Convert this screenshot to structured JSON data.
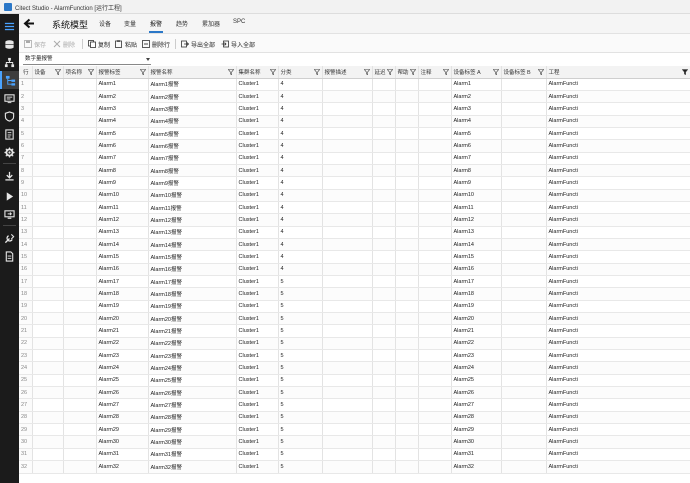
{
  "window": {
    "title": "Citect Studio - AlarmFunction [运行工程]"
  },
  "sidebar": {
    "items": [
      {
        "name": "menu-icon",
        "active": false
      },
      {
        "name": "database-icon",
        "active": false
      },
      {
        "name": "topology-icon",
        "active": false
      },
      {
        "name": "system-model-icon",
        "active": true
      },
      {
        "name": "visualization-icon",
        "active": false
      },
      {
        "name": "security-icon",
        "active": false
      },
      {
        "name": "reports-icon",
        "active": false
      },
      {
        "name": "settings-icon",
        "active": false
      },
      {
        "name": "download-icon",
        "active": false
      },
      {
        "name": "run-icon",
        "active": false
      },
      {
        "name": "deploy-icon",
        "active": false
      },
      {
        "name": "tools-icon",
        "active": false
      },
      {
        "name": "document-icon",
        "active": false
      }
    ]
  },
  "nav": {
    "title": "系统模型",
    "tabs": [
      {
        "label": "设备",
        "active": false
      },
      {
        "label": "变量",
        "active": false
      },
      {
        "label": "报警",
        "active": true
      },
      {
        "label": "趋势",
        "active": false
      },
      {
        "label": "累加器",
        "active": false
      },
      {
        "label": "SPC",
        "active": false
      }
    ]
  },
  "toolbar": {
    "save": "保存",
    "delete": "删除",
    "copy": "复制",
    "paste": "粘贴",
    "delete_row": "删除行",
    "export_all": "导出全部",
    "import_all": "导入全部"
  },
  "filter": {
    "selected": "数字量报警"
  },
  "grid": {
    "columns": [
      "行",
      "设备",
      "项名称",
      "报警标签",
      "报警名称",
      "集群名称",
      "分类",
      "报警描述",
      "延迟",
      "帮助",
      "注释",
      "设备标签 A",
      "设备标签 B",
      "工程"
    ],
    "rows": [
      [
        "1",
        "",
        "",
        "Alarm1",
        "Alarm1报警",
        "Cluster1",
        "4",
        "",
        "",
        "",
        "",
        "Alarm1",
        "",
        "AlarmFuncti"
      ],
      [
        "2",
        "",
        "",
        "Alarm2",
        "Alarm2报警",
        "Cluster1",
        "4",
        "",
        "",
        "",
        "",
        "Alarm2",
        "",
        "AlarmFuncti"
      ],
      [
        "3",
        "",
        "",
        "Alarm3",
        "Alarm3报警",
        "Cluster1",
        "4",
        "",
        "",
        "",
        "",
        "Alarm3",
        "",
        "AlarmFuncti"
      ],
      [
        "4",
        "",
        "",
        "Alarm4",
        "Alarm4报警",
        "Cluster1",
        "4",
        "",
        "",
        "",
        "",
        "Alarm4",
        "",
        "AlarmFuncti"
      ],
      [
        "5",
        "",
        "",
        "Alarm5",
        "Alarm5报警",
        "Cluster1",
        "4",
        "",
        "",
        "",
        "",
        "Alarm5",
        "",
        "AlarmFuncti"
      ],
      [
        "6",
        "",
        "",
        "Alarm6",
        "Alarm6报警",
        "Cluster1",
        "4",
        "",
        "",
        "",
        "",
        "Alarm6",
        "",
        "AlarmFuncti"
      ],
      [
        "7",
        "",
        "",
        "Alarm7",
        "Alarm7报警",
        "Cluster1",
        "4",
        "",
        "",
        "",
        "",
        "Alarm7",
        "",
        "AlarmFuncti"
      ],
      [
        "8",
        "",
        "",
        "Alarm8",
        "Alarm8报警",
        "Cluster1",
        "4",
        "",
        "",
        "",
        "",
        "Alarm8",
        "",
        "AlarmFuncti"
      ],
      [
        "9",
        "",
        "",
        "Alarm9",
        "Alarm9报警",
        "Cluster1",
        "4",
        "",
        "",
        "",
        "",
        "Alarm9",
        "",
        "AlarmFuncti"
      ],
      [
        "10",
        "",
        "",
        "Alarm10",
        "Alarm10报警",
        "Cluster1",
        "4",
        "",
        "",
        "",
        "",
        "Alarm10",
        "",
        "AlarmFuncti"
      ],
      [
        "11",
        "",
        "",
        "Alarm11",
        "Alarm11报警",
        "Cluster1",
        "4",
        "",
        "",
        "",
        "",
        "Alarm11",
        "",
        "AlarmFuncti"
      ],
      [
        "12",
        "",
        "",
        "Alarm12",
        "Alarm12报警",
        "Cluster1",
        "4",
        "",
        "",
        "",
        "",
        "Alarm12",
        "",
        "AlarmFuncti"
      ],
      [
        "13",
        "",
        "",
        "Alarm13",
        "Alarm13报警",
        "Cluster1",
        "4",
        "",
        "",
        "",
        "",
        "Alarm13",
        "",
        "AlarmFuncti"
      ],
      [
        "14",
        "",
        "",
        "Alarm14",
        "Alarm14报警",
        "Cluster1",
        "4",
        "",
        "",
        "",
        "",
        "Alarm14",
        "",
        "AlarmFuncti"
      ],
      [
        "15",
        "",
        "",
        "Alarm15",
        "Alarm15报警",
        "Cluster1",
        "4",
        "",
        "",
        "",
        "",
        "Alarm15",
        "",
        "AlarmFuncti"
      ],
      [
        "16",
        "",
        "",
        "Alarm16",
        "Alarm16报警",
        "Cluster1",
        "4",
        "",
        "",
        "",
        "",
        "Alarm16",
        "",
        "AlarmFuncti"
      ],
      [
        "17",
        "",
        "",
        "Alarm17",
        "Alarm17报警",
        "Cluster1",
        "5",
        "",
        "",
        "",
        "",
        "Alarm17",
        "",
        "AlarmFuncti"
      ],
      [
        "18",
        "",
        "",
        "Alarm18",
        "Alarm18报警",
        "Cluster1",
        "5",
        "",
        "",
        "",
        "",
        "Alarm18",
        "",
        "AlarmFuncti"
      ],
      [
        "19",
        "",
        "",
        "Alarm19",
        "Alarm19报警",
        "Cluster1",
        "5",
        "",
        "",
        "",
        "",
        "Alarm19",
        "",
        "AlarmFuncti"
      ],
      [
        "20",
        "",
        "",
        "Alarm20",
        "Alarm20报警",
        "Cluster1",
        "5",
        "",
        "",
        "",
        "",
        "Alarm20",
        "",
        "AlarmFuncti"
      ],
      [
        "21",
        "",
        "",
        "Alarm21",
        "Alarm21报警",
        "Cluster1",
        "5",
        "",
        "",
        "",
        "",
        "Alarm21",
        "",
        "AlarmFuncti"
      ],
      [
        "22",
        "",
        "",
        "Alarm22",
        "Alarm22报警",
        "Cluster1",
        "5",
        "",
        "",
        "",
        "",
        "Alarm22",
        "",
        "AlarmFuncti"
      ],
      [
        "23",
        "",
        "",
        "Alarm23",
        "Alarm23报警",
        "Cluster1",
        "5",
        "",
        "",
        "",
        "",
        "Alarm23",
        "",
        "AlarmFuncti"
      ],
      [
        "24",
        "",
        "",
        "Alarm24",
        "Alarm24报警",
        "Cluster1",
        "5",
        "",
        "",
        "",
        "",
        "Alarm24",
        "",
        "AlarmFuncti"
      ],
      [
        "25",
        "",
        "",
        "Alarm25",
        "Alarm25报警",
        "Cluster1",
        "5",
        "",
        "",
        "",
        "",
        "Alarm25",
        "",
        "AlarmFuncti"
      ],
      [
        "26",
        "",
        "",
        "Alarm26",
        "Alarm26报警",
        "Cluster1",
        "5",
        "",
        "",
        "",
        "",
        "Alarm26",
        "",
        "AlarmFuncti"
      ],
      [
        "27",
        "",
        "",
        "Alarm27",
        "Alarm27报警",
        "Cluster1",
        "5",
        "",
        "",
        "",
        "",
        "Alarm27",
        "",
        "AlarmFuncti"
      ],
      [
        "28",
        "",
        "",
        "Alarm28",
        "Alarm28报警",
        "Cluster1",
        "5",
        "",
        "",
        "",
        "",
        "Alarm28",
        "",
        "AlarmFuncti"
      ],
      [
        "29",
        "",
        "",
        "Alarm29",
        "Alarm29报警",
        "Cluster1",
        "5",
        "",
        "",
        "",
        "",
        "Alarm29",
        "",
        "AlarmFuncti"
      ],
      [
        "30",
        "",
        "",
        "Alarm30",
        "Alarm30报警",
        "Cluster1",
        "5",
        "",
        "",
        "",
        "",
        "Alarm30",
        "",
        "AlarmFuncti"
      ],
      [
        "31",
        "",
        "",
        "Alarm31",
        "Alarm31报警",
        "Cluster1",
        "5",
        "",
        "",
        "",
        "",
        "Alarm31",
        "",
        "AlarmFuncti"
      ],
      [
        "32",
        "",
        "",
        "Alarm32",
        "Alarm32报警",
        "Cluster1",
        "5",
        "",
        "",
        "",
        "",
        "Alarm32",
        "",
        "AlarmFuncti"
      ]
    ]
  }
}
